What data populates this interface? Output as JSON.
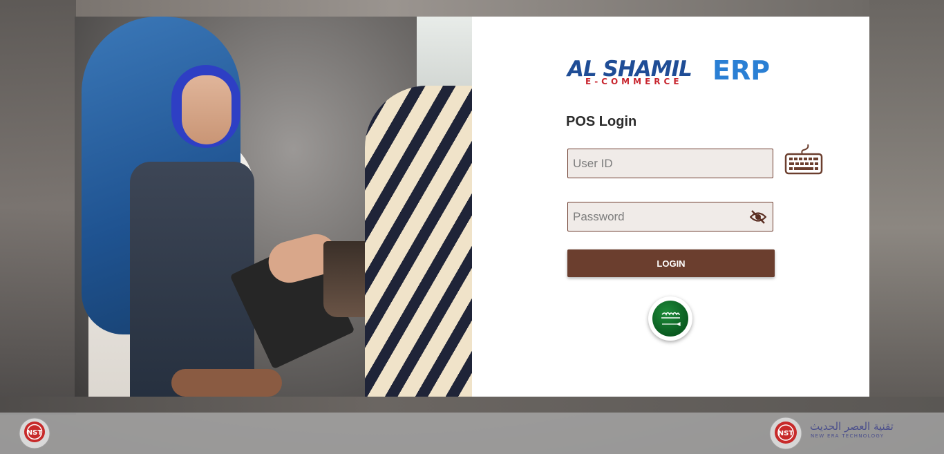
{
  "brand": {
    "logo_al_shamil": "AL SHAMIL",
    "logo_ecommerce": "E-COMMERCE",
    "logo_erp": "ERP"
  },
  "login": {
    "title": "POS Login",
    "userid_placeholder": "User ID",
    "userid_value": "",
    "password_placeholder": "Password",
    "password_value": "",
    "login_button": "LOGIN"
  },
  "language": {
    "flag": "saudi-arabia"
  },
  "footer": {
    "right_arabic": "تقنية العصر الحديث",
    "right_english": "NEW ERA TECHNOLOGY",
    "nst_mark": "NST"
  },
  "icons": {
    "keyboard": "keyboard-icon",
    "eye": "eye-off-icon"
  },
  "colors": {
    "accent": "#6b3e2e",
    "field_bg": "#f0ebe8",
    "logo_blue": "#1f4d96",
    "logo_red": "#c8262f",
    "erp_blue": "#2a7fd4"
  }
}
